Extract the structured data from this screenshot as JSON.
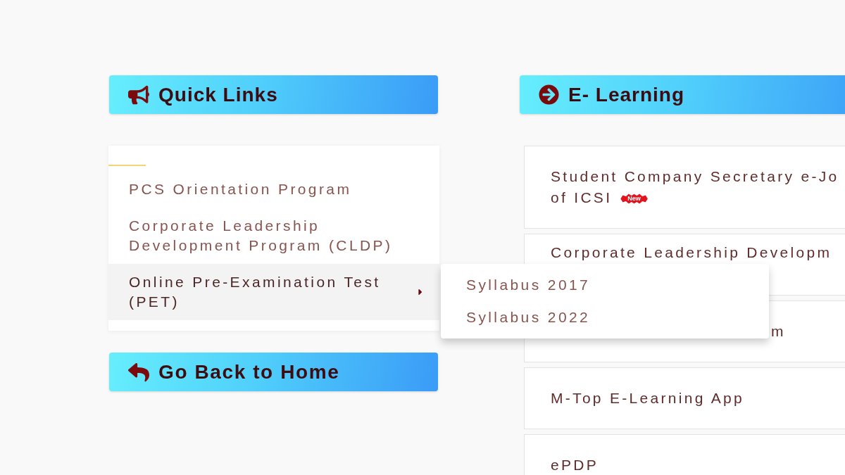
{
  "quick_links": {
    "title": "Quick Links",
    "items": [
      {
        "label": "PCS Orientation Program",
        "kind": "link",
        "expanded": false
      },
      {
        "label": "Corporate Leadership Development Program (CLDP)",
        "kind": "link",
        "expanded": false
      },
      {
        "label": "Online Pre-Examination Test (PET)",
        "kind": "submenu",
        "expanded": true,
        "children": [
          {
            "label": "Syllabus 2017"
          },
          {
            "label": "Syllabus 2022"
          }
        ]
      }
    ]
  },
  "home_button": {
    "label": "Go Back to Home"
  },
  "e_learning": {
    "title": "E- Learning",
    "cards": [
      {
        "kind": "full",
        "lines": [
          "Student Company Secretary e-Jo",
          "of ICSI"
        ],
        "badge": "New"
      },
      {
        "kind": "above_menu",
        "lines": [
          "Corporate Leadership Developm"
        ]
      },
      {
        "kind": "beside_menu",
        "lines": [
          "m"
        ]
      },
      {
        "kind": "full",
        "lines": [
          "M-Top E-Learning App"
        ]
      },
      {
        "kind": "full",
        "lines": [
          "ePDP"
        ]
      }
    ]
  }
}
